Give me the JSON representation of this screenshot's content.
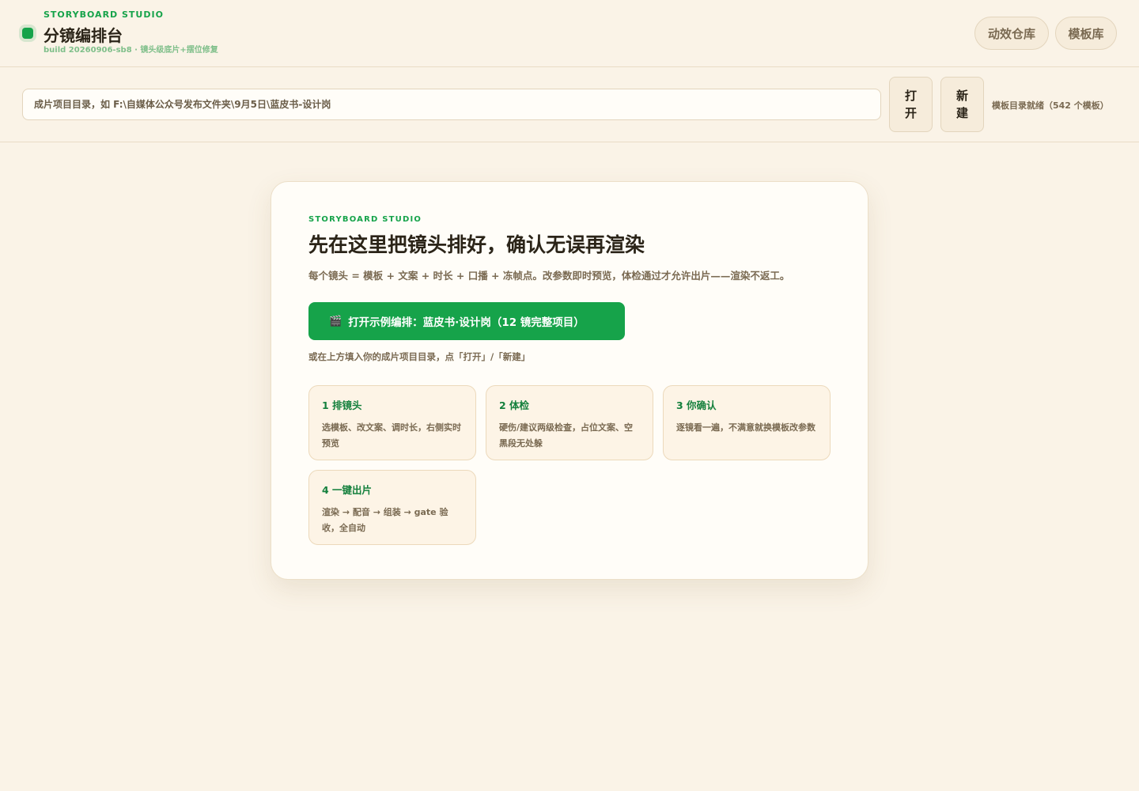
{
  "header": {
    "kicker": "STORYBOARD STUDIO",
    "title": "分镜编排台",
    "build": "build 20260906-sb8 · 镜头级底片+摆位修复",
    "buttons": {
      "motion_library": "动效仓库",
      "template_library": "模板库"
    }
  },
  "pathbar": {
    "placeholder": "成片项目目录，如 F:\\自媒体公众号发布文件夹\\9月5日\\蓝皮书-设计岗",
    "open_label": "打开",
    "new_label": "新建",
    "status": "模板目录就绪（542 个模板）"
  },
  "card": {
    "kicker": "STORYBOARD STUDIO",
    "title": "先在这里把镜头排好，确认无误再渲染",
    "description": "每个镜头 = 模板 + 文案 + 时长 + 口播 + 冻帧点。改参数即时预览，体检通过才允许出片——渲染不返工。",
    "cta_icon": "🎬",
    "cta_label": "打开示例编排：蓝皮书·设计岗（12 镜完整项目）",
    "hint": "或在上方填入你的成片项目目录，点「打开」/「新建」",
    "steps": [
      {
        "title": "1 排镜头",
        "text": "选模板、改文案、调时长，右侧实时预览"
      },
      {
        "title": "2 体检",
        "text": "硬伤/建议两级检查，占位文案、空黑段无处躲"
      },
      {
        "title": "3 你确认",
        "text": "逐镜看一遍，不满意就换模板改参数"
      },
      {
        "title": "4 一键出片",
        "text": "渲染 → 配音 → 组装 → gate 验收，全自动"
      }
    ]
  },
  "colors": {
    "accent": "#16a34a",
    "background": "#faf3e7",
    "card": "#fffdf8"
  }
}
